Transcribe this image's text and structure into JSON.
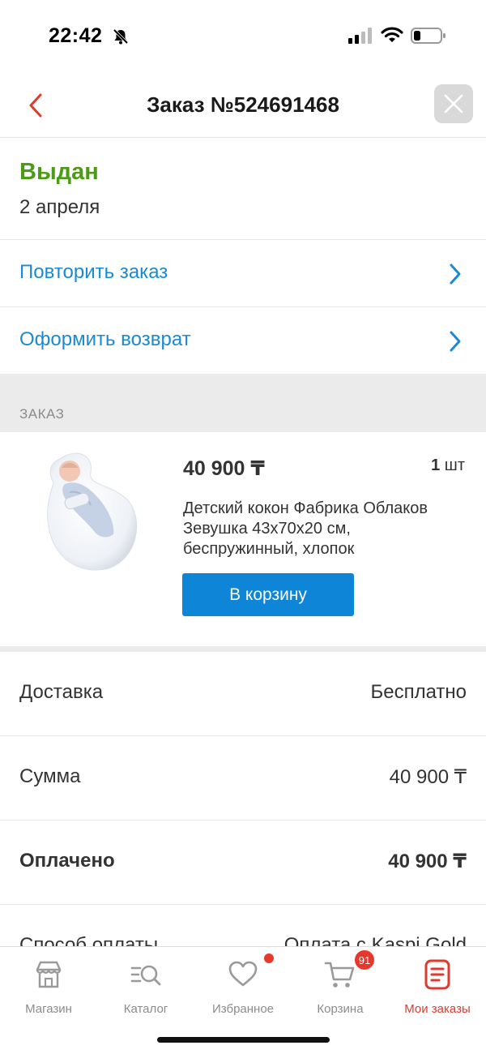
{
  "status_bar": {
    "time": "22:42"
  },
  "header": {
    "title": "Заказ №524691468"
  },
  "order_status": {
    "label": "Выдан",
    "date": "2 апреля"
  },
  "actions": [
    {
      "label": "Повторить заказ"
    },
    {
      "label": "Оформить возврат"
    }
  ],
  "section": {
    "label": "ЗАКАЗ"
  },
  "product": {
    "price": "40 900 ₸",
    "qty_number": "1",
    "qty_unit": "шт",
    "name": "Детский кокон Фабрика Облаков Зевушка 43х70х20 см, беспружинный, хлопок",
    "cart_button": "В корзину"
  },
  "summary": [
    {
      "key": "Доставка",
      "value": "Бесплатно"
    },
    {
      "key": "Сумма",
      "value": "40 900 ₸"
    },
    {
      "key": "Оплачено",
      "value": "40 900 ₸"
    },
    {
      "key": "Способ оплаты",
      "value": "Оплата с Kaspi Gold"
    }
  ],
  "tabs": [
    {
      "label": "Магазин",
      "icon": "shop-icon"
    },
    {
      "label": "Каталог",
      "icon": "catalog-icon"
    },
    {
      "label": "Избранное",
      "icon": "heart-icon"
    },
    {
      "label": "Корзина",
      "icon": "cart-icon",
      "badge": "91"
    },
    {
      "label": "Мои заказы",
      "icon": "orders-icon",
      "active": true
    }
  ],
  "colors": {
    "accent": "#e03a2f",
    "link": "#1a8ad4",
    "status_green": "#4c9b16",
    "button_blue": "#0f85d8"
  }
}
